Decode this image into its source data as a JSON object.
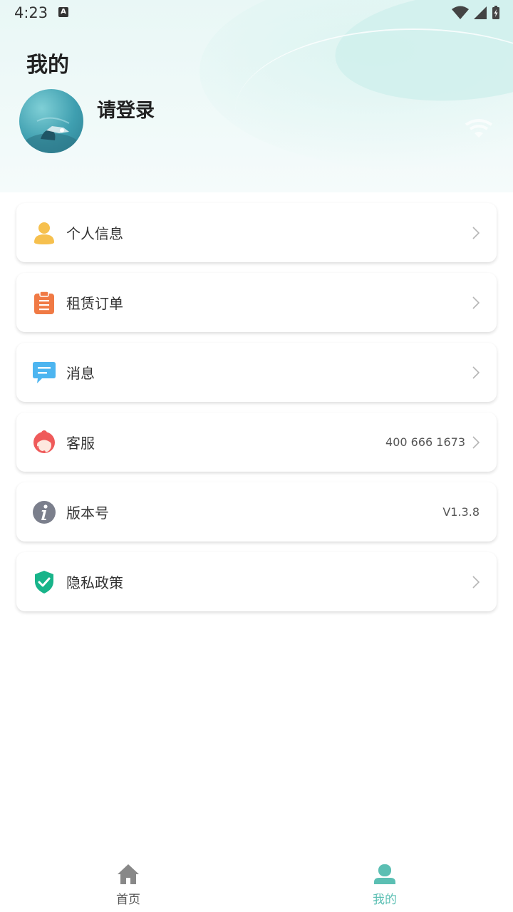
{
  "status_bar": {
    "time": "4:23",
    "notification_badge": "A"
  },
  "header": {
    "title": "我的",
    "login_prompt": "请登录"
  },
  "menu": [
    {
      "label": "个人信息",
      "icon": "user-icon",
      "value": "",
      "has_chevron": true
    },
    {
      "label": "租赁订单",
      "icon": "clipboard-icon",
      "value": "",
      "has_chevron": true
    },
    {
      "label": "消息",
      "icon": "message-icon",
      "value": "",
      "has_chevron": true
    },
    {
      "label": "客服",
      "icon": "customer-service-icon",
      "value": "400 666 1673",
      "has_chevron": true
    },
    {
      "label": "版本号",
      "icon": "info-icon",
      "value": "V1.3.8",
      "has_chevron": false
    },
    {
      "label": "隐私政策",
      "icon": "shield-check-icon",
      "value": "",
      "has_chevron": true
    }
  ],
  "tabbar": {
    "home_label": "首页",
    "mine_label": "我的",
    "active_tab": "我的"
  },
  "colors": {
    "accent": "#5bbfb3",
    "inactive": "#888888",
    "header_bg": "#eaf7f6",
    "user_icon": "#f6c04e",
    "order_icon": "#f07a45",
    "message_icon": "#4db5f0",
    "service_icon": "#ef5a5a",
    "info_icon": "#7b7f8c",
    "privacy_icon": "#18b48a"
  }
}
